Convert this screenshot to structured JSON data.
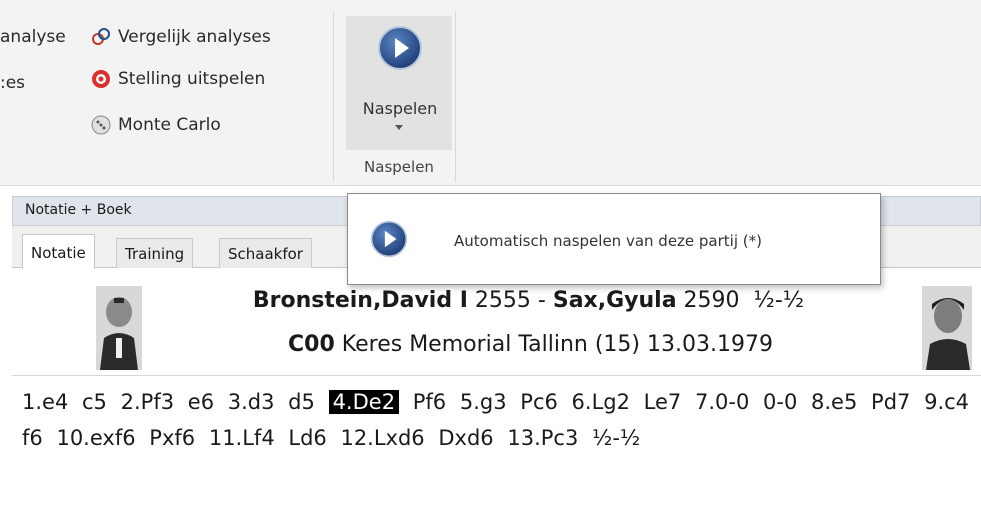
{
  "ribbon": {
    "left_col": {
      "item1": "analyse",
      "item2": ":es"
    },
    "right_col": {
      "compare": "Vergelijk analyses",
      "playout": "Stelling uitspelen",
      "monte_carlo": "Monte Carlo"
    },
    "naspelen_button": "Naspelen",
    "group_label": "Naspelen"
  },
  "panel": {
    "title": "Notatie + Boek",
    "tabs": [
      "Notatie",
      "Training",
      "Schaakfor"
    ]
  },
  "game": {
    "white": "Bronstein,David I",
    "white_elo": "2555",
    "separator": " - ",
    "black": "Sax,Gyula",
    "black_elo": "2590",
    "result": "½-½",
    "eco": "C00",
    "event": "Keres Memorial Tallinn (15) 13.03.1979"
  },
  "moves": [
    "1.e4",
    "c5",
    "2.Pf3",
    "e6",
    "3.d3",
    "d5",
    "4.De2",
    "Pf6",
    "5.g3",
    "Pc6",
    "6.Lg2",
    "Le7",
    "7.0-0",
    "0-0",
    "8.e5",
    "Pd7",
    "9.c4",
    "f6",
    "10.exf6",
    "Pxf6",
    "11.Lf4",
    "Ld6",
    "12.Lxd6",
    "Dxd6",
    "13.Pc3",
    "½-½"
  ],
  "current_move": "4.De2",
  "tooltip": {
    "text": "Automatisch naspelen van deze partij (*)"
  },
  "colors": {
    "accent": "#1f4e8c",
    "highlight_bg": "#000000",
    "ribbon_bg": "#f3f3f3"
  }
}
